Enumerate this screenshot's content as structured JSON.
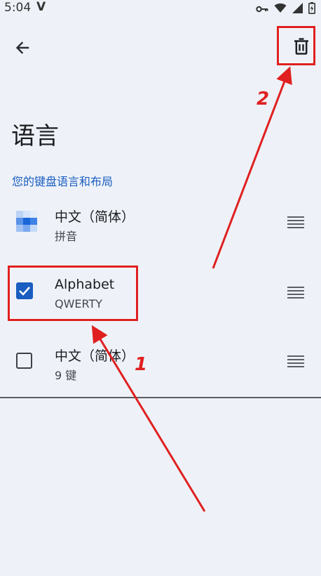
{
  "status": {
    "time": "5:04",
    "carrier_mark": "V",
    "icons": [
      "key-icon",
      "wifi-icon",
      "signal-icon",
      "battery-icon"
    ]
  },
  "toolbar": {
    "back_icon": "arrow-left-icon",
    "delete_icon": "trash-icon"
  },
  "title": "语言",
  "section_header": "您的键盘语言和布局",
  "layouts": [
    {
      "primary": "中文（简体）",
      "secondary": "拼音",
      "leading": "pinyin-tile-icon",
      "selected": null
    },
    {
      "primary": "Alphabet",
      "secondary": "QWERTY",
      "leading": "checkbox",
      "selected": true
    },
    {
      "primary": "中文（简体）",
      "secondary": "9 键",
      "leading": "checkbox",
      "selected": false
    }
  ],
  "annotations": {
    "step1": "1",
    "step2": "2",
    "color": "#e02020"
  },
  "colors": {
    "background": "#eef2f8",
    "accent": "#1a5dc0",
    "text": "#1b1c1f"
  }
}
